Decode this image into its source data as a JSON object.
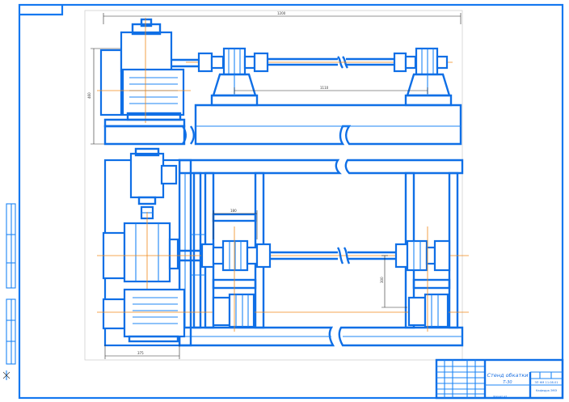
{
  "drawing": {
    "title_line1": "Стенд обкатки",
    "title_line2": "Т-30",
    "stamp_code": "ЗП НМ 11.08.01",
    "stamp_note": "Кафедра ЭМЭ",
    "sheet_note": "Формат A3"
  },
  "dimensions": {
    "overall_length": "1200",
    "frame_height": "460",
    "shaft_span": "1110",
    "coupling_gap": "180",
    "shaft_offset": "300",
    "base_width": "375"
  },
  "colors": {
    "line": "#1478f0",
    "axis": "#f08a1a",
    "dim": "#2a2a2a"
  }
}
